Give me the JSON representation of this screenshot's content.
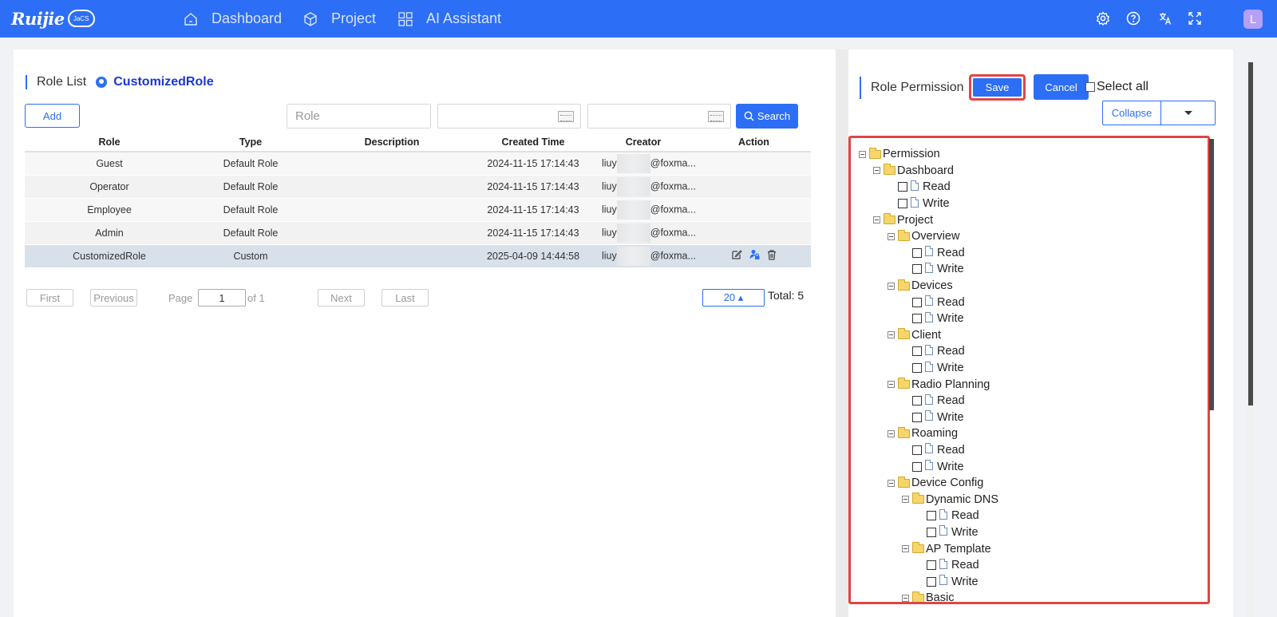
{
  "topbar": {
    "logo": "Ruijie",
    "logo_badge": "JaCS",
    "nav": [
      {
        "label": "Dashboard",
        "icon": "home-icon"
      },
      {
        "label": "Project",
        "icon": "cube-icon"
      },
      {
        "label": "AI Assistant",
        "icon": "grid-icon"
      }
    ],
    "avatar_letter": "L",
    "brand_color": "#2c6ef6"
  },
  "role_list": {
    "title": "Role List",
    "current_role": "CustomizedRole",
    "add_label": "Add",
    "role_placeholder": "Role",
    "search_label": "Search",
    "columns": [
      "Role",
      "Type",
      "Description",
      "Created Time",
      "Creator",
      "Action"
    ],
    "rows": [
      {
        "role": "Guest",
        "type": "Default Role",
        "description": "",
        "created": "2024-11-15 17:14:43",
        "creator_prefix": "liuy",
        "creator_suffix": "@foxma..."
      },
      {
        "role": "Operator",
        "type": "Default Role",
        "description": "",
        "created": "2024-11-15 17:14:43",
        "creator_prefix": "liuy",
        "creator_suffix": "@foxma..."
      },
      {
        "role": "Employee",
        "type": "Default Role",
        "description": "",
        "created": "2024-11-15 17:14:43",
        "creator_prefix": "liuy",
        "creator_suffix": "@foxma..."
      },
      {
        "role": "Admin",
        "type": "Default Role",
        "description": "",
        "created": "2024-11-15 17:14:43",
        "creator_prefix": "liuy",
        "creator_suffix": "@foxma..."
      },
      {
        "role": "CustomizedRole",
        "type": "Custom",
        "description": "",
        "created": "2025-04-09 14:44:58",
        "creator_prefix": "liuy",
        "creator_suffix": "@foxma..."
      }
    ],
    "pager": {
      "first": "First",
      "previous": "Previous",
      "page_label": "Page",
      "page_value": "1",
      "of_label": "of 1",
      "next": "Next",
      "last": "Last",
      "page_size": "20 ▴",
      "total": "Total: 5"
    }
  },
  "permission": {
    "title": "Role Permission",
    "save_label": "Save",
    "cancel_label": "Cancel",
    "select_all_label": "Select all",
    "collapse_label": "Collapse",
    "tree": [
      {
        "label": "Permission",
        "level": 0,
        "kind": "folder"
      },
      {
        "label": "Dashboard",
        "level": 1,
        "kind": "folder"
      },
      {
        "label": "Read",
        "level": 2,
        "kind": "leaf"
      },
      {
        "label": "Write",
        "level": 2,
        "kind": "leaf"
      },
      {
        "label": "Project",
        "level": 1,
        "kind": "folder"
      },
      {
        "label": "Overview",
        "level": 2,
        "kind": "folder"
      },
      {
        "label": "Read",
        "level": 3,
        "kind": "leaf"
      },
      {
        "label": "Write",
        "level": 3,
        "kind": "leaf"
      },
      {
        "label": "Devices",
        "level": 2,
        "kind": "folder"
      },
      {
        "label": "Read",
        "level": 3,
        "kind": "leaf"
      },
      {
        "label": "Write",
        "level": 3,
        "kind": "leaf"
      },
      {
        "label": "Client",
        "level": 2,
        "kind": "folder"
      },
      {
        "label": "Read",
        "level": 3,
        "kind": "leaf"
      },
      {
        "label": "Write",
        "level": 3,
        "kind": "leaf"
      },
      {
        "label": "Radio Planning",
        "level": 2,
        "kind": "folder"
      },
      {
        "label": "Read",
        "level": 3,
        "kind": "leaf"
      },
      {
        "label": "Write",
        "level": 3,
        "kind": "leaf"
      },
      {
        "label": "Roaming",
        "level": 2,
        "kind": "folder"
      },
      {
        "label": "Read",
        "level": 3,
        "kind": "leaf"
      },
      {
        "label": "Write",
        "level": 3,
        "kind": "leaf"
      },
      {
        "label": "Device Config",
        "level": 2,
        "kind": "folder"
      },
      {
        "label": "Dynamic DNS",
        "level": 3,
        "kind": "folder"
      },
      {
        "label": "Read",
        "level": 4,
        "kind": "leaf"
      },
      {
        "label": "Write",
        "level": 4,
        "kind": "leaf"
      },
      {
        "label": "AP Template",
        "level": 3,
        "kind": "folder"
      },
      {
        "label": "Read",
        "level": 4,
        "kind": "leaf"
      },
      {
        "label": "Write",
        "level": 4,
        "kind": "leaf"
      },
      {
        "label": "Basic",
        "level": 3,
        "kind": "folder"
      }
    ]
  }
}
